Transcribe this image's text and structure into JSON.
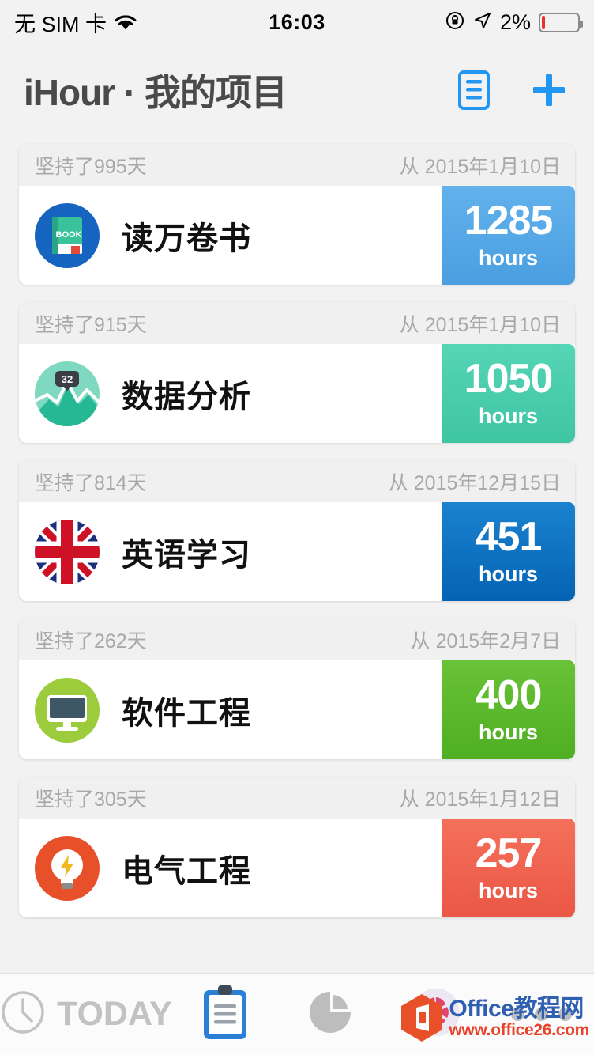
{
  "statusbar": {
    "carrier": "无 SIM 卡",
    "wifi_icon": "wifi-icon",
    "time": "16:03",
    "rotation_lock_icon": "rotation-lock-icon",
    "location_icon": "location-arrow-icon",
    "battery_percent": "2%",
    "battery_level": 2
  },
  "navbar": {
    "title": "iHour · 我的项目",
    "list_button": "list-view-button",
    "add_button": "add-project-button"
  },
  "projects": [
    {
      "streak": "坚持了995天",
      "since": "从 2015年1月10日",
      "name": "读万卷书",
      "hours": "1285",
      "unit": "hours",
      "badge_color": "#56a9e8",
      "icon": "book-icon",
      "icon_bg": "#1565c0",
      "icon_label": "BOOK"
    },
    {
      "streak": "坚持了915天",
      "since": "从 2015年1月10日",
      "name": "数据分析",
      "hours": "1050",
      "unit": "hours",
      "badge_color": "#4ecfb0",
      "icon": "chart-analysis-icon",
      "icon_bg": "#6ad3b5",
      "icon_label": "32"
    },
    {
      "streak": "坚持了814天",
      "since": "从 2015年12月15日",
      "name": "英语学习",
      "hours": "451",
      "unit": "hours",
      "badge_color": "#0d72c4",
      "icon": "uk-flag-icon",
      "icon_bg": "#1d3a8a",
      "icon_label": ""
    },
    {
      "streak": "坚持了262天",
      "since": "从 2015年2月7日",
      "name": "软件工程",
      "hours": "400",
      "unit": "hours",
      "badge_color": "#5cb82e",
      "icon": "desktop-monitor-icon",
      "icon_bg": "#9ccc3c",
      "icon_label": ""
    },
    {
      "streak": "坚持了305天",
      "since": "从 2015年1月12日",
      "name": "电气工程",
      "hours": "257",
      "unit": "hours",
      "badge_color": "#ef6450",
      "icon": "lightbulb-icon",
      "icon_bg": "#e8502a",
      "icon_label": ""
    }
  ],
  "tabbar": {
    "today_label": "TODAY",
    "tabs": [
      {
        "name": "tab-today",
        "icon": "clock-icon",
        "active": false
      },
      {
        "name": "tab-projects",
        "icon": "clipboard-icon",
        "active": true
      },
      {
        "name": "tab-statistics",
        "icon": "pie-chart-icon",
        "active": false
      },
      {
        "name": "tab-awards",
        "icon": "pinwheel-icon",
        "active": false
      },
      {
        "name": "tab-more",
        "icon": "more-dots-icon",
        "active": false
      }
    ]
  },
  "watermark": {
    "title": "Office教程网",
    "url": "www.office26.com"
  }
}
